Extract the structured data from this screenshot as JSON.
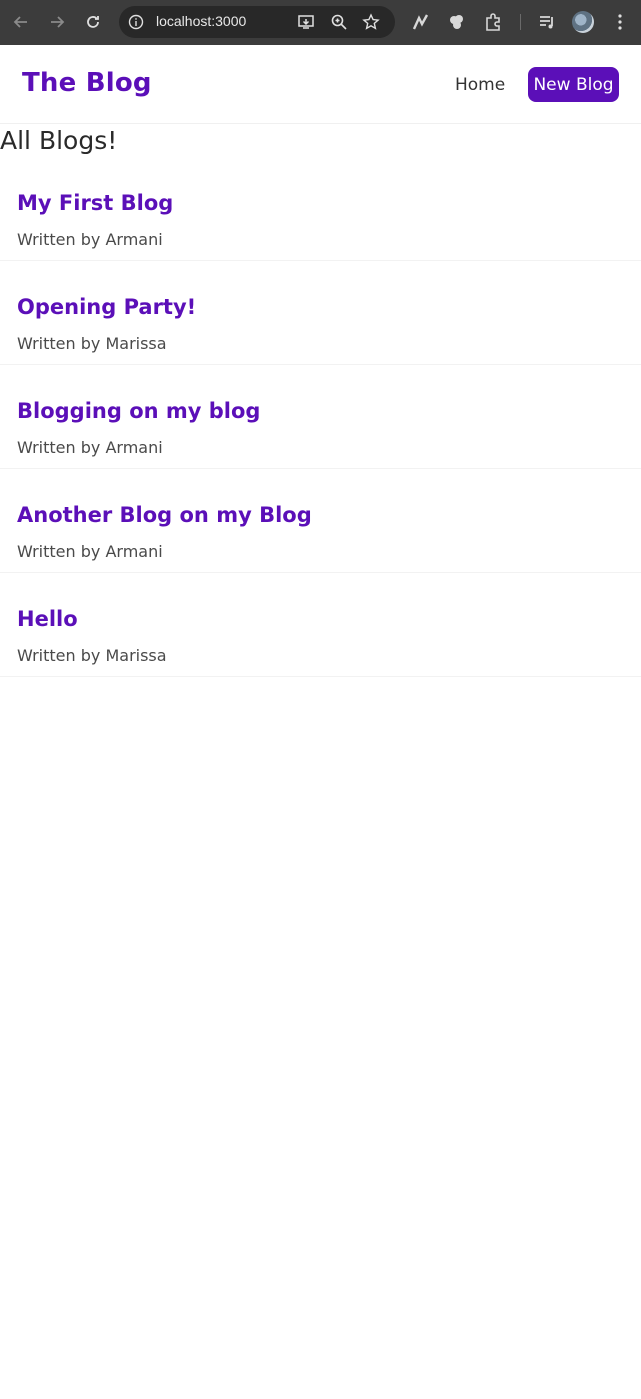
{
  "browser": {
    "url": "localhost:3000"
  },
  "navbar": {
    "brand": "The Blog",
    "home_label": "Home",
    "new_blog_label": "New Blog"
  },
  "main": {
    "heading": "All Blogs!",
    "blogs": [
      {
        "title": "My First Blog",
        "author_line": "Written by Armani"
      },
      {
        "title": "Opening Party!",
        "author_line": "Written by Marissa"
      },
      {
        "title": "Blogging on my blog",
        "author_line": "Written by Armani"
      },
      {
        "title": "Another Blog on my Blog",
        "author_line": "Written by Armani"
      },
      {
        "title": "Hello",
        "author_line": "Written by Marissa"
      }
    ]
  },
  "colors": {
    "accent": "#5b0fb8",
    "chrome": "#3c3c3c"
  }
}
